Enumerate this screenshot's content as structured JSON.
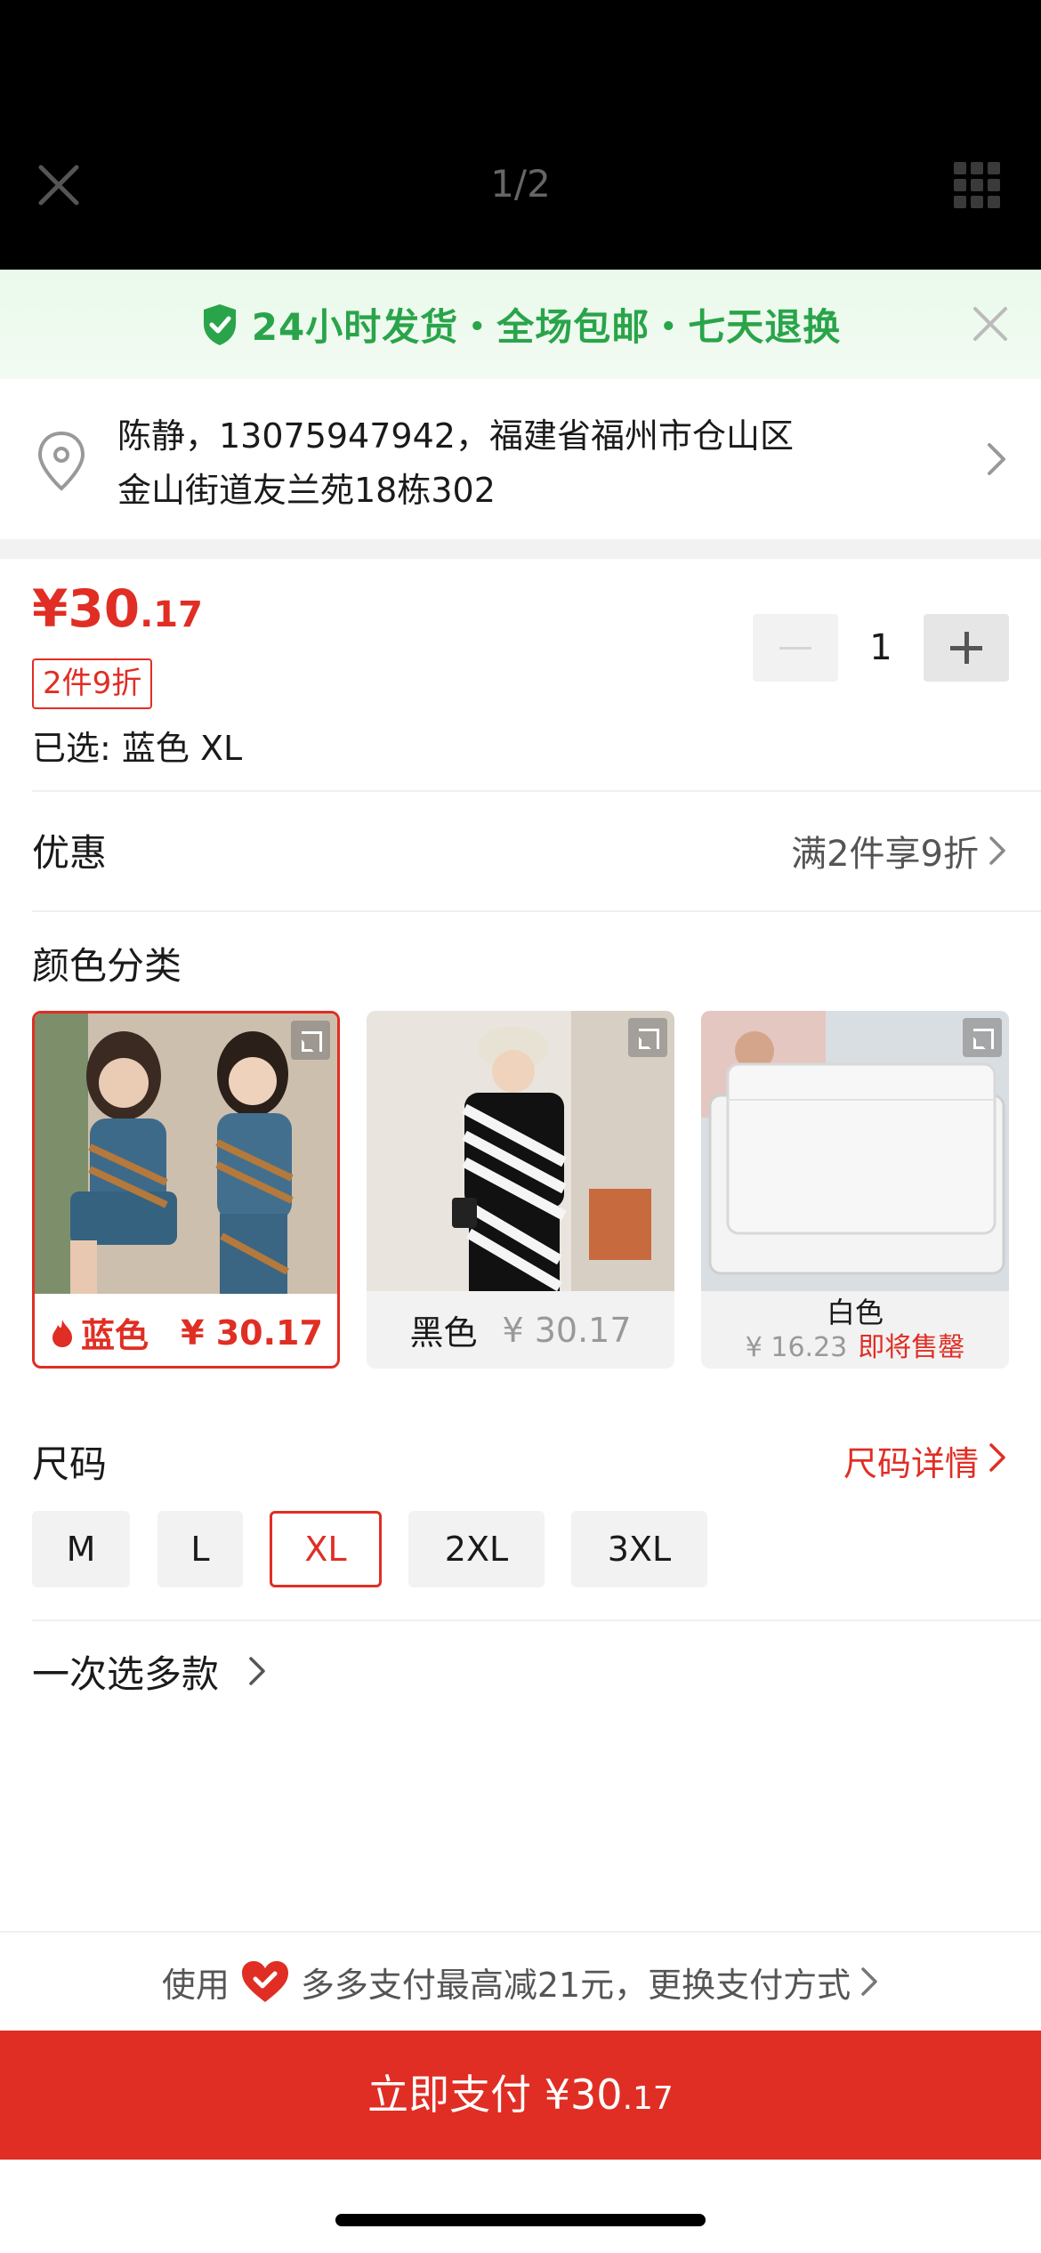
{
  "viewer": {
    "pager": "1/2"
  },
  "banner": {
    "text": "24小时发货・全场包邮・七天退换"
  },
  "address": {
    "line1": "陈静，13075947942，福建省福州市仓山区",
    "line2": "金山街道友兰苑18栋302"
  },
  "product": {
    "price_symbol": "¥",
    "price_int": "30",
    "price_dec": ".17",
    "discount_tag": "2件9折",
    "selected": "已选: 蓝色 XL",
    "quantity": "1"
  },
  "promo": {
    "label": "优惠",
    "value": "满2件享9折"
  },
  "colors": {
    "title": "颜色分类",
    "options": [
      {
        "name": "蓝色",
        "price": "¥ 30.17",
        "selected": true
      },
      {
        "name": "黑色",
        "price": "¥ 30.17"
      },
      {
        "name": "白色",
        "price": "¥ 16.23",
        "note": "即将售罄"
      }
    ]
  },
  "sizes": {
    "title": "尺码",
    "detail_link": "尺码详情",
    "options": [
      "M",
      "L",
      "XL",
      "2XL",
      "3XL"
    ],
    "selected": "XL"
  },
  "multi_select": "一次选多款",
  "payment": {
    "tip_prefix": "使用",
    "tip_suffix": "多多支付最高减21元，更换支付方式",
    "button_label": "立即支付 ¥30",
    "button_decimal": ".17"
  },
  "colors_theme": {
    "accent": "#e02e24",
    "banner_green": "#2aa44a"
  }
}
